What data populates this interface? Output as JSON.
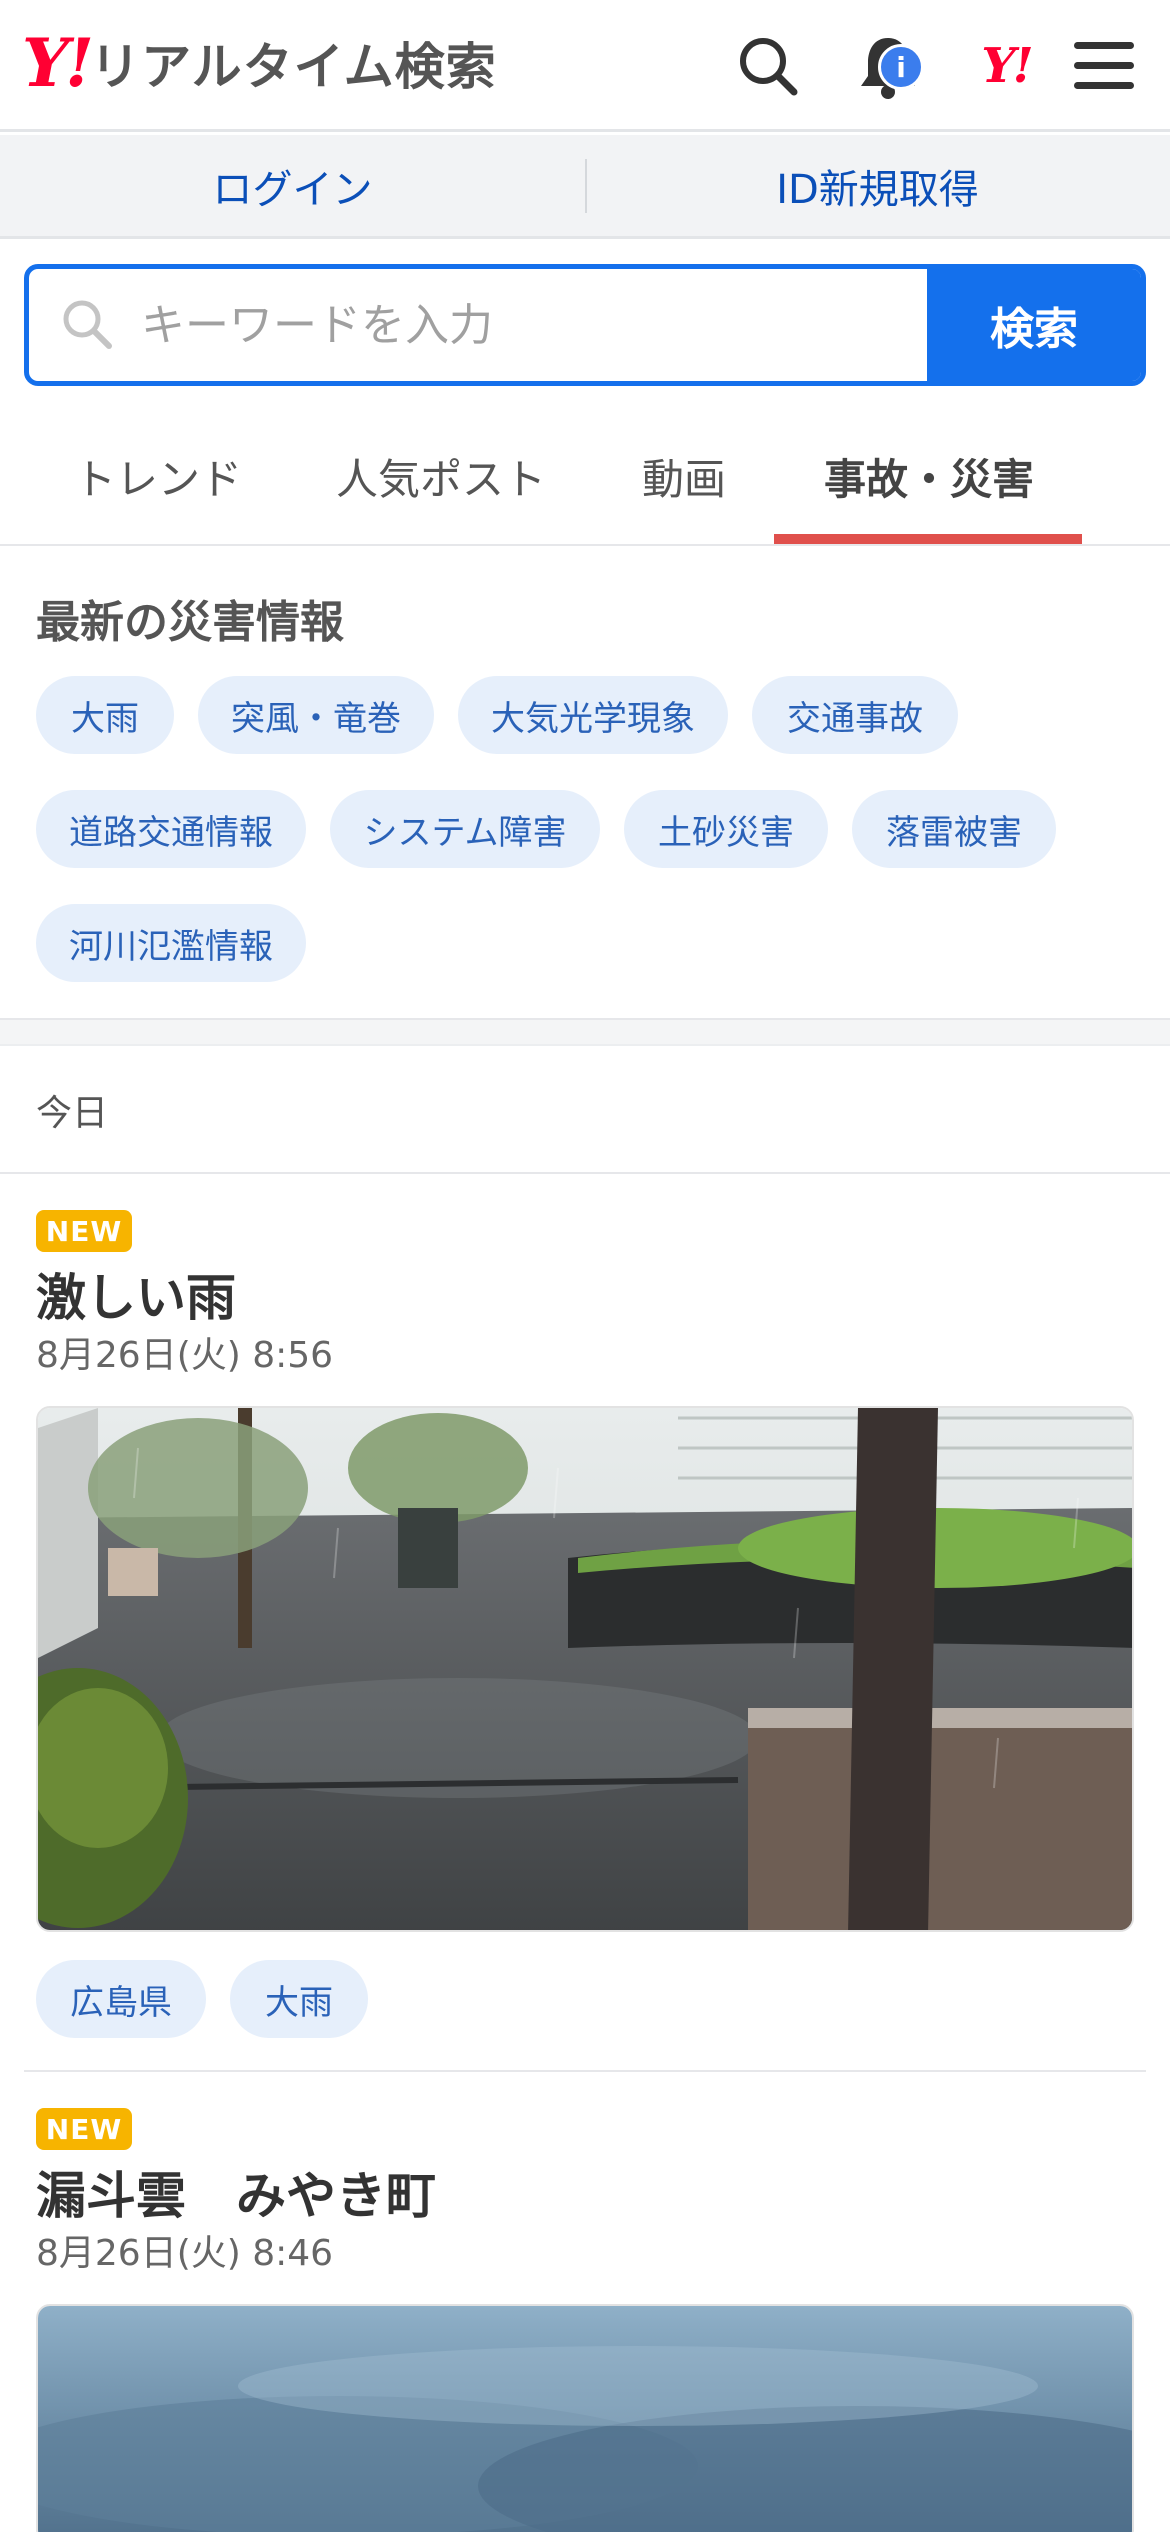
{
  "header": {
    "logo_mark": "Y!",
    "logo_text": "リアルタイム検索",
    "notification_badge": "i",
    "yahoo_mini": "Y!"
  },
  "auth": {
    "login": "ログイン",
    "register": "ID新規取得"
  },
  "search": {
    "placeholder": "キーワードを入力",
    "button": "検索"
  },
  "tabs": [
    {
      "label": "トレンド",
      "active": false
    },
    {
      "label": "人気ポスト",
      "active": false
    },
    {
      "label": "動画",
      "active": false
    },
    {
      "label": "事故・災害",
      "active": true
    }
  ],
  "disaster": {
    "title": "最新の災害情報",
    "chips": [
      "大雨",
      "突風・竜巻",
      "大気光学現象",
      "交通事故",
      "道路交通情報",
      "システム障害",
      "土砂災害",
      "落雷被害",
      "河川氾濫情報"
    ]
  },
  "feed": {
    "section_label": "今日",
    "posts": [
      {
        "badge": "NEW",
        "title": "激しい雨",
        "time": "8月26日(火) 8:56",
        "tags": [
          "広島県",
          "大雨"
        ]
      },
      {
        "badge": "NEW",
        "title": "漏斗雲　みやき町",
        "time": "8月26日(火) 8:46"
      }
    ]
  },
  "colors": {
    "brand_red": "#ff0033",
    "accent_blue": "#1470ec",
    "active_tab": "#e0504c",
    "new_badge": "#f7b400"
  }
}
